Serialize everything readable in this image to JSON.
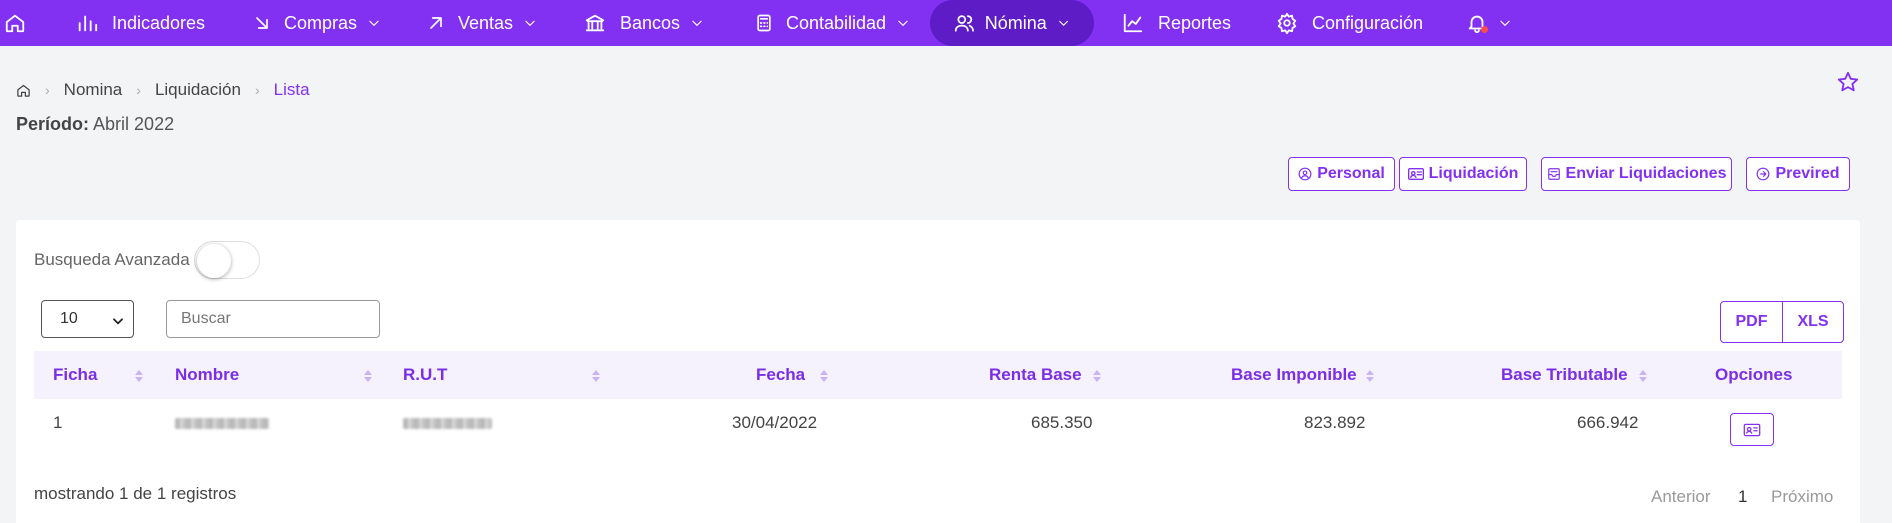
{
  "nav": {
    "items": [
      {
        "label": "Indicadores",
        "icon": "bar-chart-icon"
      },
      {
        "label": "Compras",
        "icon": "arrow-down-right-icon"
      },
      {
        "label": "Ventas",
        "icon": "arrow-up-right-icon"
      },
      {
        "label": "Bancos",
        "icon": "bank-icon"
      },
      {
        "label": "Contabilidad",
        "icon": "calculator-icon"
      },
      {
        "label": "Nómina",
        "icon": "users-icon",
        "active": true
      },
      {
        "label": "Reportes",
        "icon": "line-chart-icon"
      },
      {
        "label": "Configuración",
        "icon": "gear-icon"
      }
    ]
  },
  "breadcrumb": {
    "items": [
      "Nomina",
      "Liquidación"
    ],
    "current": "Lista"
  },
  "periodo": {
    "label": "Período:",
    "value": "Abril 2022"
  },
  "actions": {
    "personal": "Personal",
    "liquidacion": "Liquidación",
    "enviar": "Enviar Liquidaciones",
    "previred": "Previred"
  },
  "filters": {
    "advanced_label": "Busqueda Avanzada",
    "advanced_on": false,
    "page_size": "10",
    "search_placeholder": "Buscar"
  },
  "export": {
    "pdf": "PDF",
    "xls": "XLS"
  },
  "table": {
    "columns": [
      "Ficha",
      "Nombre",
      "R.U.T",
      "Fecha",
      "Renta Base",
      "Base Imponible",
      "Base Tributable",
      "Opciones"
    ],
    "rows": [
      {
        "ficha": "1",
        "fecha": "30/04/2022",
        "renta_base": "685.350",
        "base_imponible": "823.892",
        "base_tributable": "666.942"
      }
    ]
  },
  "footer": {
    "summary": "mostrando 1 de 1 registros",
    "prev": "Anterior",
    "page": "1",
    "next": "Próximo"
  },
  "colors": {
    "primary": "#8230f2",
    "primary_dark": "#5e1cc7",
    "header_row": "#f5f1fd",
    "alert_dot": "#ff4d4f"
  }
}
